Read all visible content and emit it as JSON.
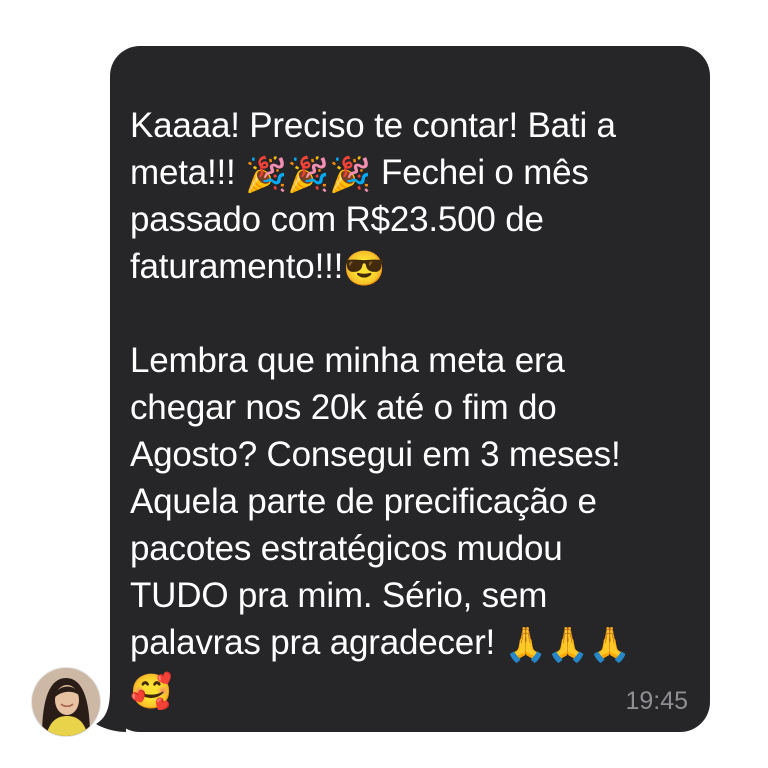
{
  "message": {
    "paragraph1": {
      "line1": "Kaaaa! Preciso te contar! Bati a",
      "line2_before": "meta!!! ",
      "line2_emojis": "🎉🎉🎉",
      "line2_after": " Fechei o mês",
      "line3": "passado com R$23.500 de",
      "line4_text": "faturamento!!!",
      "line4_emoji": "😎"
    },
    "paragraph2": {
      "line1": "Lembra que minha meta era",
      "line2": "chegar nos 20k até o fim do",
      "line3": "Agosto? Consegui em 3 meses!",
      "line4": "Aquela parte de precificação e",
      "line5": "pacotes estratégicos mudou",
      "line6": "TUDO pra mim. Sério, sem",
      "line7_text": "palavras pra agradecer! ",
      "line7_emojis": "🙏🙏🙏",
      "line8_emoji": "🥰"
    },
    "timestamp": "19:45"
  },
  "colors": {
    "bubble_background": "#262628",
    "message_text": "#ffffff",
    "timestamp_text": "#8e8e93",
    "page_background": "#ffffff"
  },
  "icons": {
    "avatar": "sender-avatar-photo",
    "party": "party-popper-emoji",
    "sunglasses": "smiling-face-with-sunglasses-emoji",
    "pray": "folded-hands-emoji",
    "hearts": "smiling-face-with-hearts-emoji"
  }
}
